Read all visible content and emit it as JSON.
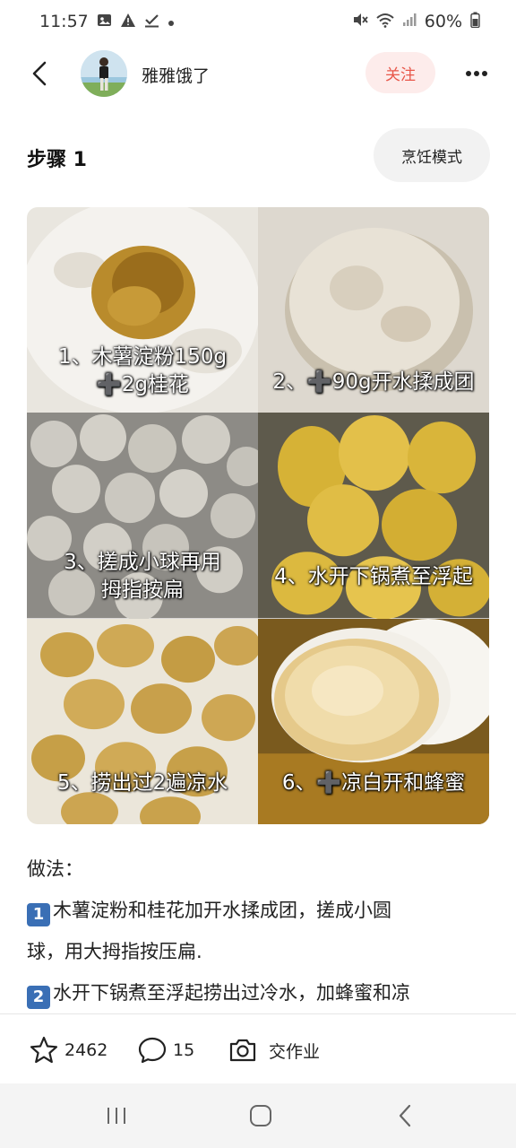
{
  "status": {
    "time": "11:57",
    "battery": "60%",
    "icons": [
      "image-icon",
      "warning-icon",
      "check-icon",
      "dot-icon",
      "mute-icon",
      "wifi-icon",
      "signal-icon",
      "battery-icon"
    ]
  },
  "header": {
    "author_name": "雅雅饿了",
    "follow_label": "关注"
  },
  "step": {
    "title": "步骤 1",
    "cook_mode_label": "烹饪模式"
  },
  "photos": [
    {
      "caption_line1": "1、木薯淀粉150g",
      "caption_line2": "➕2g桂花"
    },
    {
      "caption_line1": "2、➕90g开水揉成团",
      "caption_line2": ""
    },
    {
      "caption_line1": "3、搓成小球再用",
      "caption_line2": "拇指按扁"
    },
    {
      "caption_line1": "4、水开下锅煮至浮起",
      "caption_line2": ""
    },
    {
      "caption_line1": "5、捞出过2遍凉水",
      "caption_line2": ""
    },
    {
      "caption_line1": "6、➕凉白开和蜂蜜",
      "caption_line2": ""
    }
  ],
  "method": {
    "heading": "做法：",
    "lines": [
      {
        "badge": "1",
        "text": "木薯淀粉和桂花加开水揉成团，搓成小圆"
      },
      {
        "badge": "",
        "text": "球，用大拇指按压扁."
      },
      {
        "badge": "2",
        "text": "水开下锅煮至浮起捞出过冷水，加蜂蜜和凉"
      }
    ]
  },
  "actions": {
    "stars": "2462",
    "comments": "15",
    "homework_label": "交作业"
  },
  "colors": {
    "follow_bg": "#fdeceb",
    "follow_text": "#e8574a",
    "badge_blue": "#3a6fb5"
  }
}
